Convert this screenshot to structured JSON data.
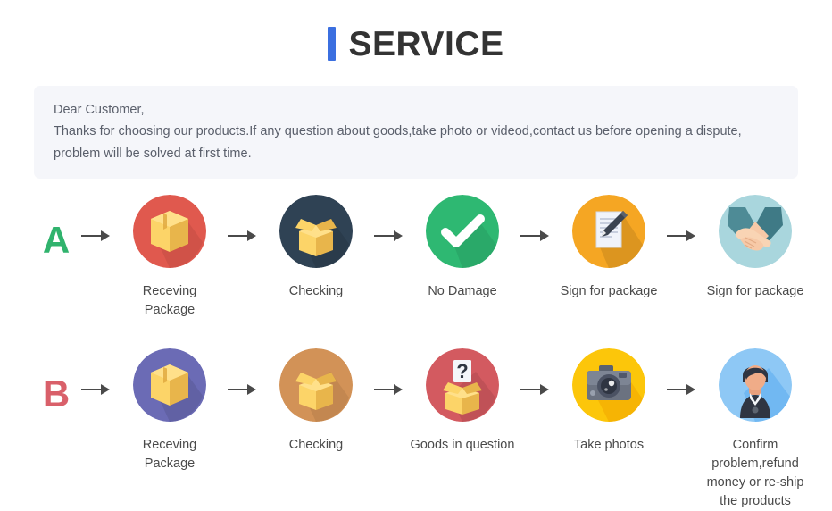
{
  "header": {
    "title": "SERVICE",
    "accent_color": "#3b6fe0"
  },
  "notice": {
    "greeting": "Dear Customer,",
    "line1": "Thanks for choosing our products.If any question about goods,take photo or videod,contact us before opening a dispute,",
    "line2": "problem will be solved at first time.",
    "background_color": "#f5f6fa"
  },
  "flows": [
    {
      "letter": "A",
      "letter_color": "#30b36d",
      "steps": [
        {
          "label": "Receving Package",
          "icon": "closed-box-icon",
          "circle_color": "#e0594e"
        },
        {
          "label": "Checking",
          "icon": "open-box-icon",
          "circle_color": "#2f4254"
        },
        {
          "label": "No Damage",
          "icon": "check-mark-icon",
          "circle_color": "#2eb872"
        },
        {
          "label": "Sign for package",
          "icon": "document-pen-icon",
          "circle_color": "#f5a623"
        },
        {
          "label": "Sign for package",
          "icon": "handshake-icon",
          "circle_color": "#a9d6dd"
        }
      ]
    },
    {
      "letter": "B",
      "letter_color": "#d9606a",
      "steps": [
        {
          "label": "Receving Package",
          "icon": "closed-box-icon",
          "circle_color": "#6b6bb5"
        },
        {
          "label": "Checking",
          "icon": "open-box-icon",
          "circle_color": "#d29257"
        },
        {
          "label": "Goods in question",
          "icon": "box-question-icon",
          "circle_color": "#d35a60"
        },
        {
          "label": "Take photos",
          "icon": "camera-icon",
          "circle_color": "#fcc60a"
        },
        {
          "label": "Confirm  problem,refund money or re-ship the products",
          "icon": "support-agent-icon",
          "circle_color": "#8ec8f5"
        }
      ]
    }
  ]
}
